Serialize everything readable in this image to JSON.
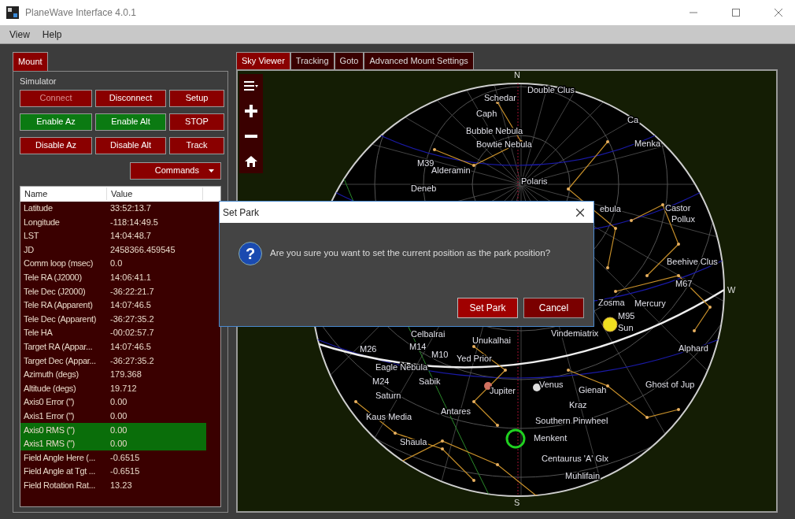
{
  "window": {
    "title": "PlaneWave Interface 4.0.1"
  },
  "menu": [
    "View",
    "Help"
  ],
  "left_tabs": [
    {
      "label": "Mount",
      "selected": true
    }
  ],
  "mount": {
    "group_label": "Simulator",
    "buttons": [
      {
        "label": "Connect",
        "kind": "red",
        "disabled": true
      },
      {
        "label": "Disconnect",
        "kind": "red",
        "disabled": false
      },
      {
        "label": "Setup",
        "kind": "red",
        "disabled": false
      },
      {
        "label": "Enable Az",
        "kind": "green",
        "disabled": false
      },
      {
        "label": "Enable Alt",
        "kind": "green",
        "disabled": false
      },
      {
        "label": "STOP",
        "kind": "red",
        "disabled": false
      },
      {
        "label": "Disable Az",
        "kind": "red",
        "disabled": false
      },
      {
        "label": "Disable Alt",
        "kind": "red",
        "disabled": false
      },
      {
        "label": "Track",
        "kind": "red",
        "disabled": false
      }
    ],
    "commands": "Commands"
  },
  "table": {
    "columns": [
      "Name",
      "Value"
    ],
    "rows": [
      {
        "name": "Latitude",
        "value": "33:52:13.7",
        "highlighted": false
      },
      {
        "name": "Longitude",
        "value": "-118:14:49.5",
        "highlighted": false
      },
      {
        "name": "LST",
        "value": "14:04:48.7",
        "highlighted": false
      },
      {
        "name": "JD",
        "value": "2458366.459545",
        "highlighted": false
      },
      {
        "name": "Comm loop (msec)",
        "value": "0.0",
        "highlighted": false
      },
      {
        "name": "Tele RA (J2000)",
        "value": "14:06:41.1",
        "highlighted": false
      },
      {
        "name": "Tele Dec (J2000)",
        "value": "-36:22:21.7",
        "highlighted": false
      },
      {
        "name": "Tele RA (Apparent)",
        "value": "14:07:46.5",
        "highlighted": false
      },
      {
        "name": "Tele Dec (Apparent)",
        "value": "-36:27:35.2",
        "highlighted": false
      },
      {
        "name": "Tele HA",
        "value": "-00:02:57.7",
        "highlighted": false
      },
      {
        "name": "Target RA (Appar...",
        "value": "14:07:46.5",
        "highlighted": false
      },
      {
        "name": "Target Dec (Appar...",
        "value": "-36:27:35.2",
        "highlighted": false
      },
      {
        "name": "Azimuth (degs)",
        "value": "179.368",
        "highlighted": false
      },
      {
        "name": "Altitude (degs)",
        "value": "19.712",
        "highlighted": false
      },
      {
        "name": "Axis0 Error (\")",
        "value": "0.00",
        "highlighted": false
      },
      {
        "name": "Axis1 Error (\")",
        "value": "0.00",
        "highlighted": false
      },
      {
        "name": "Axis0 RMS (\")",
        "value": "0.00",
        "highlighted": true
      },
      {
        "name": "Axis1 RMS (\")",
        "value": "0.00",
        "highlighted": true
      },
      {
        "name": "Field Angle Here (...",
        "value": "-0.6515",
        "highlighted": false
      },
      {
        "name": "Field Angle at Tgt ...",
        "value": "-0.6515",
        "highlighted": false
      },
      {
        "name": "Field Rotation Rat...",
        "value": "13.23",
        "highlighted": false
      }
    ]
  },
  "right_tabs": [
    {
      "label": "Sky Viewer",
      "selected": true
    },
    {
      "label": "Tracking",
      "selected": false
    },
    {
      "label": "Goto",
      "selected": false
    },
    {
      "label": "Advanced Mount Settings",
      "selected": false
    }
  ],
  "sky": {
    "compass": [
      "N",
      "W",
      "S"
    ],
    "labels": [
      "Double Clus",
      "Schedar",
      "Caph",
      "Bubble Nebula",
      "Bowtie Nebula",
      "M39",
      "Alderamin",
      "Polaris",
      "Deneb",
      "Ca",
      "Menka",
      "Castor",
      "Pollux",
      "ebula",
      "Beehive Clus",
      "M67",
      "Zosma",
      "Mercury",
      "M95",
      "Sun",
      "Celbalrai",
      "M14",
      "Unukalhai",
      "Vindemiatrix",
      "M26",
      "M10",
      "Yed Prior",
      "Alphard",
      "Eagle Nebula",
      "M24",
      "Sabik",
      "Venus",
      "Jupiter",
      "Gienah",
      "Ghost of Jup",
      "Saturn",
      "Antares",
      "Kraz",
      "Kaus Media",
      "Southern Pinwheel",
      "Shaula",
      "Menkent",
      "Centaurus 'A' Glx",
      "Muhlifain"
    ]
  },
  "dialog": {
    "title": "Set Park",
    "icon_glyph": "?",
    "message": "Are you sure you want to set the current position as the park position?",
    "buttons": [
      {
        "label": "Set Park",
        "selected": true
      },
      {
        "label": "Cancel",
        "selected": false
      }
    ]
  }
}
